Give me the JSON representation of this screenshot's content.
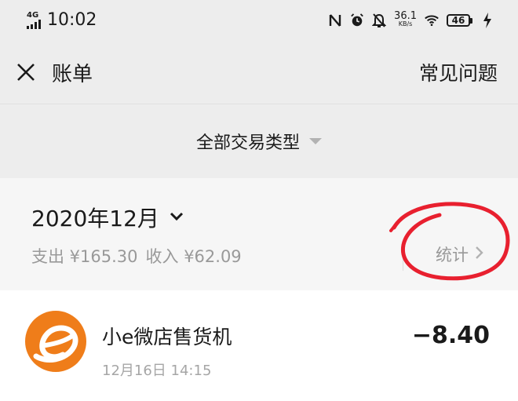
{
  "status_bar": {
    "network": "4G",
    "time": "10:02",
    "speed_value": "36.1",
    "speed_unit": "KB/s",
    "battery": "46"
  },
  "nav": {
    "title": "账单",
    "faq": "常见问题"
  },
  "filter": {
    "label": "全部交易类型"
  },
  "month": {
    "label": "2020年12月",
    "expense": "支出 ¥165.30",
    "income": "收入 ¥62.09",
    "stats_label": "统计"
  },
  "transactions": [
    {
      "merchant": "小e微店售货机",
      "time": "12月16日 14:15",
      "amount": "−8.40"
    }
  ],
  "colors": {
    "page_bg": "#ededed",
    "section_bg": "#f6f6f6",
    "logo_orange": "#ef7d1a",
    "annotation_red": "#e8202f",
    "muted_text": "#999999"
  }
}
